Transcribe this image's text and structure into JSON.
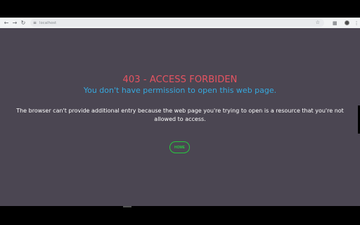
{
  "browser": {
    "url": "localhost",
    "icons": {
      "back": "back-arrow-icon",
      "forward": "forward-arrow-icon",
      "reload": "reload-icon",
      "site_info": "tune-icon",
      "bookmark": "star-icon",
      "extensions": "puzzle-icon",
      "profile": "avatar",
      "menu": "kebab-menu-icon"
    }
  },
  "page": {
    "title": "403 - ACCESS FORBIDEN",
    "subtitle": "You don't have permission to open this web page.",
    "description": "The browser can't provide additional entry because the web page you're trying to open is a resource that you're not allowed to access.",
    "home_label": "HOME"
  },
  "colors": {
    "background": "#4b4652",
    "title": "#e65361",
    "subtitle": "#36a9df",
    "description": "#ffffff",
    "home_button": "#27c93f"
  }
}
